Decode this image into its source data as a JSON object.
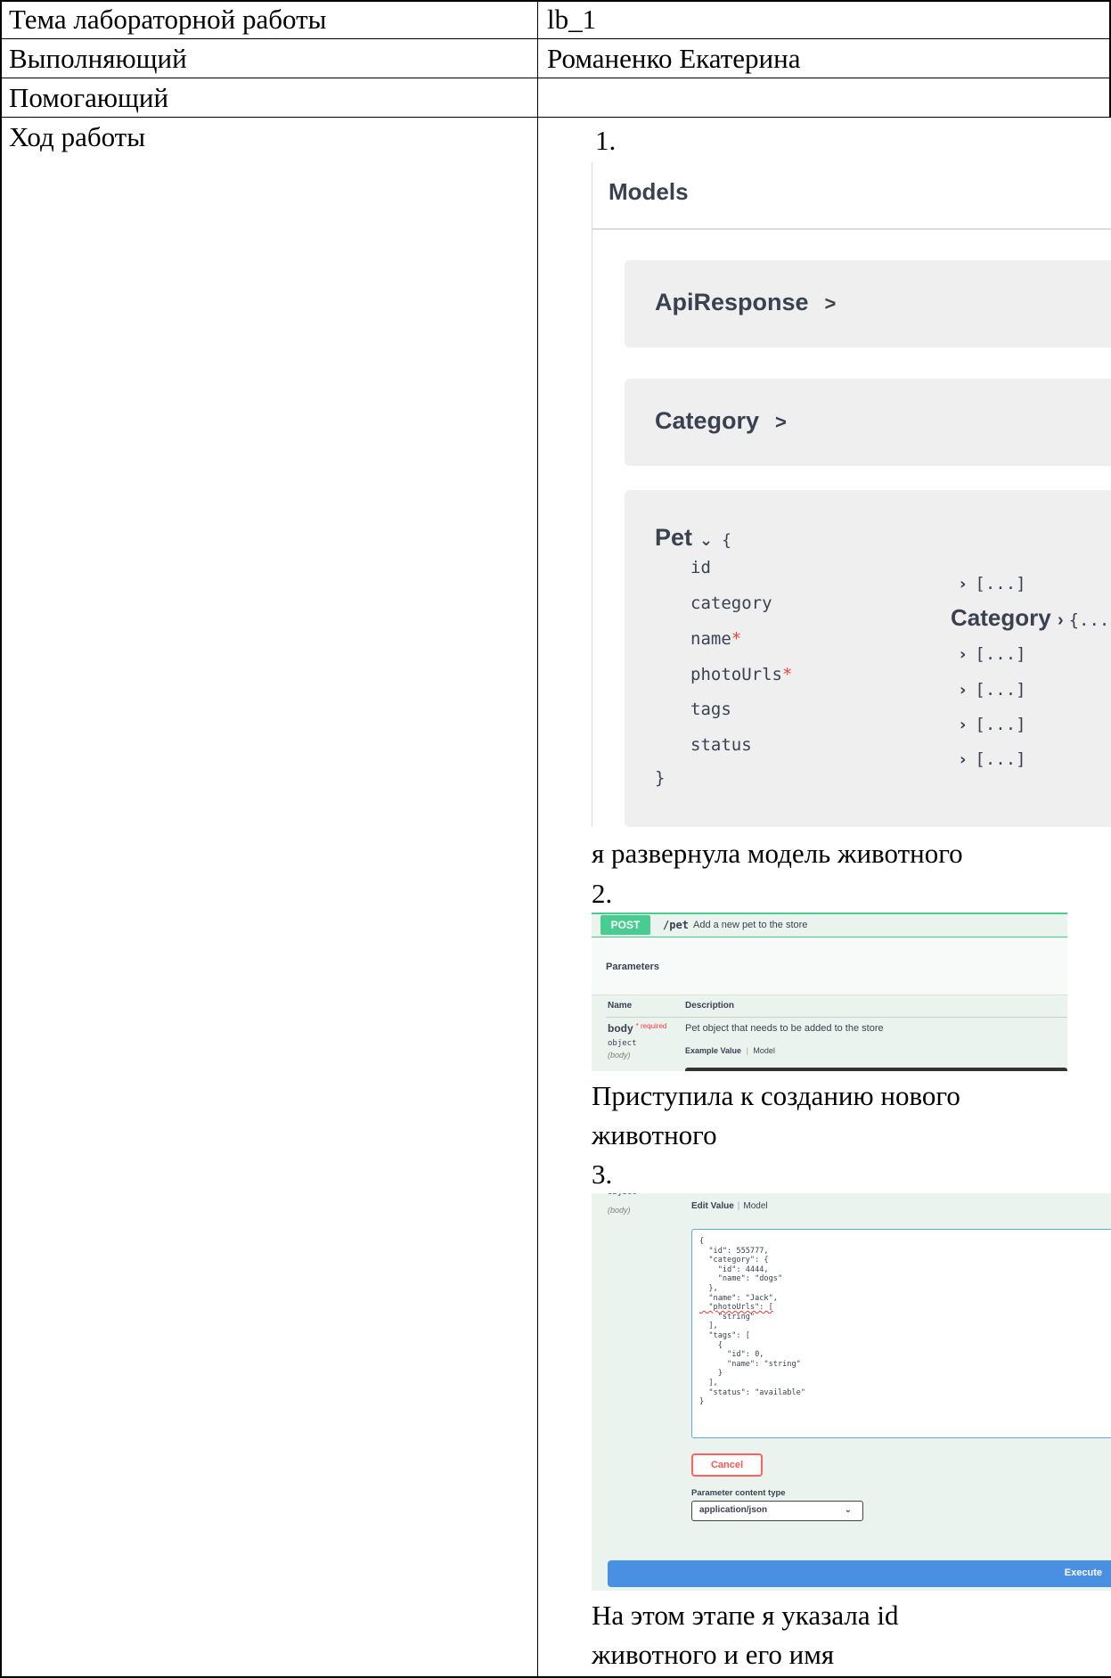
{
  "table": {
    "rows": [
      {
        "label": "Тема лабораторной работы",
        "value": "lb_1"
      },
      {
        "label": "Выполняющий",
        "value": "Романенко Екатерина"
      },
      {
        "label": "Помогающий",
        "value": ""
      },
      {
        "label": "Ход работы",
        "value": ""
      }
    ]
  },
  "steps": [
    {
      "number": "1.",
      "caption": "я развернула модель животного"
    },
    {
      "number": "2.",
      "caption_lines": [
        "Приступила к созданию нового",
        "животного"
      ]
    },
    {
      "number": "3.",
      "caption_lines": [
        "На этом этапе я указала id",
        "животного и его имя"
      ]
    }
  ],
  "models_shot": {
    "title": "Models",
    "items": [
      {
        "name": "ApiResponse",
        "chevron": ">"
      },
      {
        "name": "Category",
        "chevron": ">"
      }
    ],
    "pet": {
      "name": "Pet",
      "open_brace": "{",
      "close_brace": "}",
      "properties": [
        {
          "name": "id",
          "required": false,
          "value": "[...]"
        },
        {
          "name": "category",
          "required": false,
          "value_model": "Category",
          "value": "{...}"
        },
        {
          "name": "name",
          "required": true,
          "value": "[...]"
        },
        {
          "name": "photoUrls",
          "required": true,
          "value": "[...]"
        },
        {
          "name": "tags",
          "required": false,
          "value": "[...]"
        },
        {
          "name": "status",
          "required": false,
          "value": "[...]"
        }
      ],
      "required_mark": "*"
    }
  },
  "post_shot": {
    "method": "POST",
    "path": "/pet",
    "summary": "Add a new pet to the store",
    "parameters_title": "Parameters",
    "col_name": "Name",
    "col_description": "Description",
    "param_name": "body",
    "param_required": "* required",
    "param_type": "object",
    "param_in": "(body)",
    "param_description": "Pet object that needs to be added to the store",
    "example_tab": "Example Value",
    "model_tab": "Model",
    "tab_separator": "|"
  },
  "edit_shot": {
    "param_type_cut": "object",
    "param_in": "(body)",
    "edit_tab": "Edit Value",
    "model_tab": "Model",
    "tab_separator": "|",
    "code_lines": [
      "{",
      "  \"id\": 555777,",
      "  \"category\": {",
      "    \"id\": 4444,",
      "    \"name\": \"dogs\"",
      "  },",
      "  \"name\": \"Jack\",",
      "  \"photoUrls\": [",
      "    \"string\"",
      "  ],",
      "  \"tags\": [",
      "    {",
      "      \"id\": 0,",
      "      \"name\": \"string\"",
      "    }",
      "  ],",
      "  \"status\": \"available\"",
      "}"
    ],
    "cancel_label": "Cancel",
    "content_type_label": "Parameter content type",
    "content_type_value": "application/json",
    "execute_label": "Execute"
  },
  "colors": {
    "post_green": "#49cc90",
    "execute_blue": "#4990e2",
    "cancel_red": "#ff6060",
    "required_red": "#f93e3e",
    "swagger_text": "#3b4151"
  }
}
